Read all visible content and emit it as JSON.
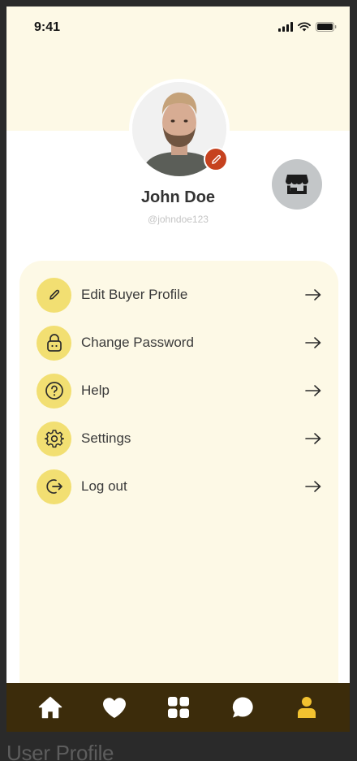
{
  "status_bar": {
    "time": "9:41"
  },
  "profile": {
    "name": "John Doe",
    "username": "@johndoe123"
  },
  "menu": [
    {
      "label": "Edit Buyer Profile",
      "icon": "pencil-icon"
    },
    {
      "label": "Change Password",
      "icon": "lock-icon"
    },
    {
      "label": "Help",
      "icon": "help-circle-icon"
    },
    {
      "label": "Settings",
      "icon": "gear-icon"
    },
    {
      "label": "Log out",
      "icon": "logout-icon"
    }
  ],
  "tabs": [
    {
      "icon": "home-icon",
      "active": false
    },
    {
      "icon": "heart-icon",
      "active": false
    },
    {
      "icon": "grid-icon",
      "active": false
    },
    {
      "icon": "chat-icon",
      "active": false
    },
    {
      "icon": "user-icon",
      "active": true
    }
  ],
  "colors": {
    "hero_bg": "#fdf9e6",
    "menu_icon_bg": "#f2df72",
    "tab_bar_bg": "#3c2c0b",
    "active_tab": "#f2c230",
    "edit_badge": "#c6421f"
  },
  "caption": "User Profile"
}
